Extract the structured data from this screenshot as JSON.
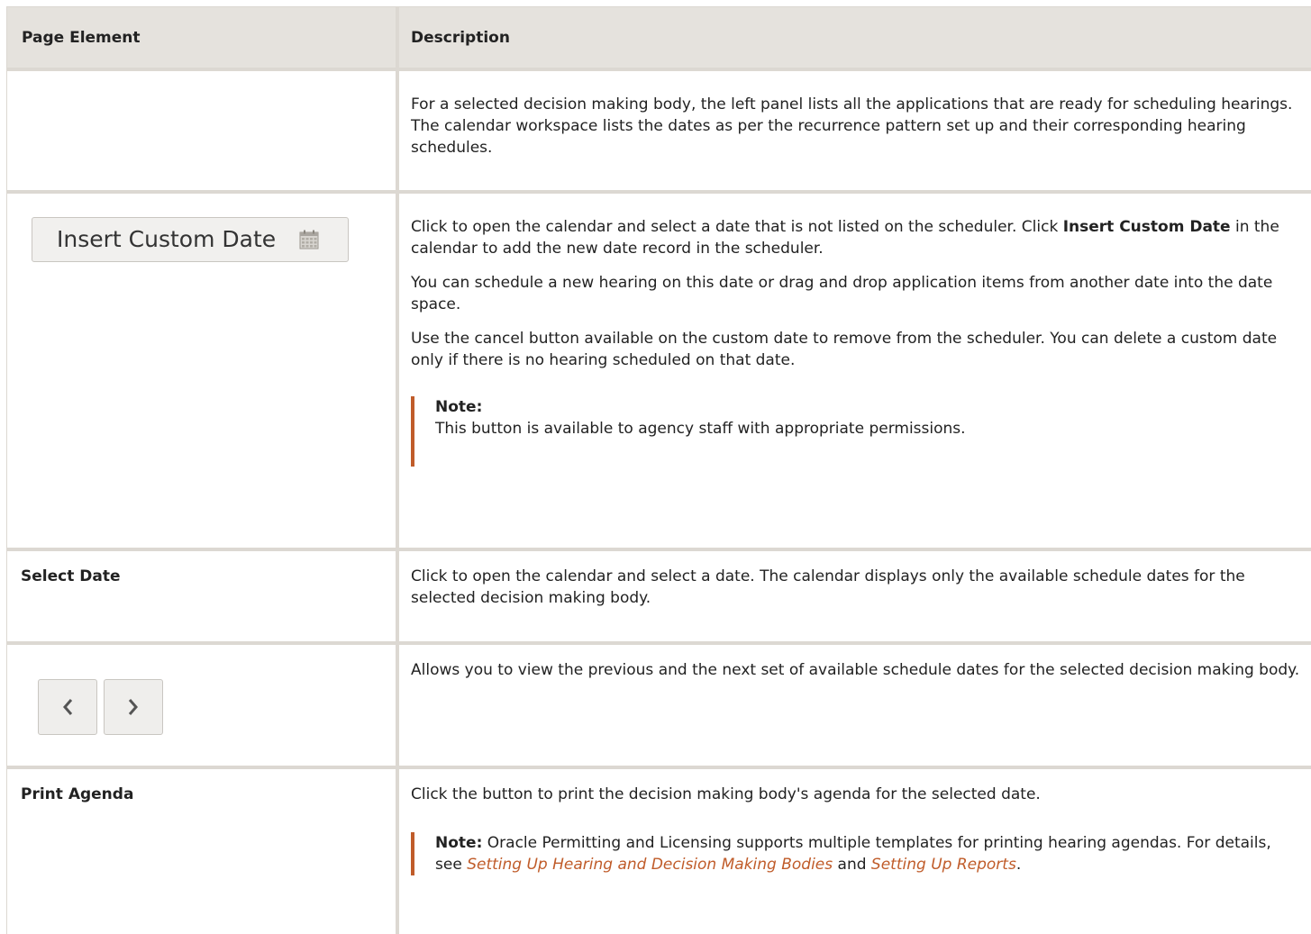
{
  "table": {
    "header": {
      "element": "Page Element",
      "description": "Description"
    },
    "row1": {
      "description": "For a selected decision making body, the left panel lists all the applications that are ready for scheduling hearings. The calendar workspace lists the dates as per the recurrence pattern set up and their corresponding hearing schedules."
    },
    "row2": {
      "button_label": "Insert Custom Date",
      "button_icon": "calendar-icon",
      "desc_p1_a": "Click to open the calendar and select a date that is not listed on the scheduler. Click ",
      "desc_p1_bold": "Insert Custom Date",
      "desc_p1_b": " in the calendar to add the new date record in the scheduler.",
      "desc_p2": "You can schedule a new hearing on this date or drag and drop application items from another date into the date space.",
      "desc_p3": "Use the cancel button available on the custom date to remove from the scheduler. You can delete a custom date only if there is no hearing scheduled on that date.",
      "note_title": "Note:",
      "note_text": "This button is available to agency staff with appropriate permissions."
    },
    "row3": {
      "element": "Select Date",
      "description": "Click to open the calendar and select a date. The calendar displays only the available schedule dates for the selected decision making body."
    },
    "row4": {
      "prev_icon": "chevron-left-icon",
      "next_icon": "chevron-right-icon",
      "description": "Allows you to view the previous and the next set of available schedule dates for the selected decision making body."
    },
    "row5": {
      "element": "Print Agenda",
      "description": "Click the button to print the decision making body's agenda for the selected date.",
      "note_title": "Note:",
      "note_text_a": " Oracle Permitting and Licensing supports multiple templates for printing hearing agendas. For details, see ",
      "link1": "Setting Up Hearing and Decision Making Bodies",
      "note_and": " and ",
      "link2": "Setting Up Reports",
      "note_end": "."
    }
  },
  "colors": {
    "header_bg": "#e5e2dd",
    "border": "#dcd8d2",
    "accent": "#c05c2a",
    "button_bg": "#f1f0ee"
  }
}
